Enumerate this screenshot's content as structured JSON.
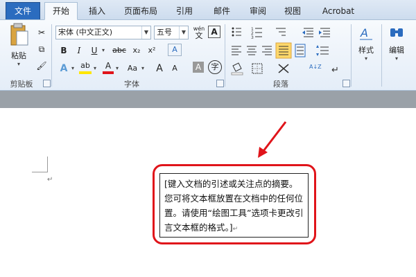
{
  "tabs": [
    "文件",
    "开始",
    "插入",
    "页面布局",
    "引用",
    "邮件",
    "审阅",
    "视图",
    "Acrobat"
  ],
  "clipboard": {
    "paste_label": "粘贴",
    "group_label": "剪贴板"
  },
  "font": {
    "font_name": "宋体 (中文正文)",
    "font_size": "五号",
    "wen_label": "wén",
    "bold": "B",
    "italic": "I",
    "underline": "U",
    "strike": "abc",
    "subscript": "x₂",
    "superscript": "x²",
    "clear": "A",
    "text_effect": "A",
    "highlight": "ab",
    "color": "A",
    "change_case": "Aa",
    "grow": "A",
    "shrink": "A",
    "char_shade": "A",
    "enclose": "字",
    "group_label": "字体"
  },
  "paragraph": {
    "group_label": "段落",
    "sort_label": "A↓Z"
  },
  "styles": {
    "label": "样式"
  },
  "editing": {
    "label": "编辑"
  },
  "document": {
    "paragraph_mark": "↵",
    "quote_text": "[键入文档的引述或关注点的摘要。您可将文本框放置在文档中的任何位置。请使用“绘图工具”选项卡更改引言文本框的格式。]",
    "quote_end_mark": "↵"
  },
  "colors": {
    "accent": "#2b6cbf",
    "highlight": "#e0141a"
  }
}
